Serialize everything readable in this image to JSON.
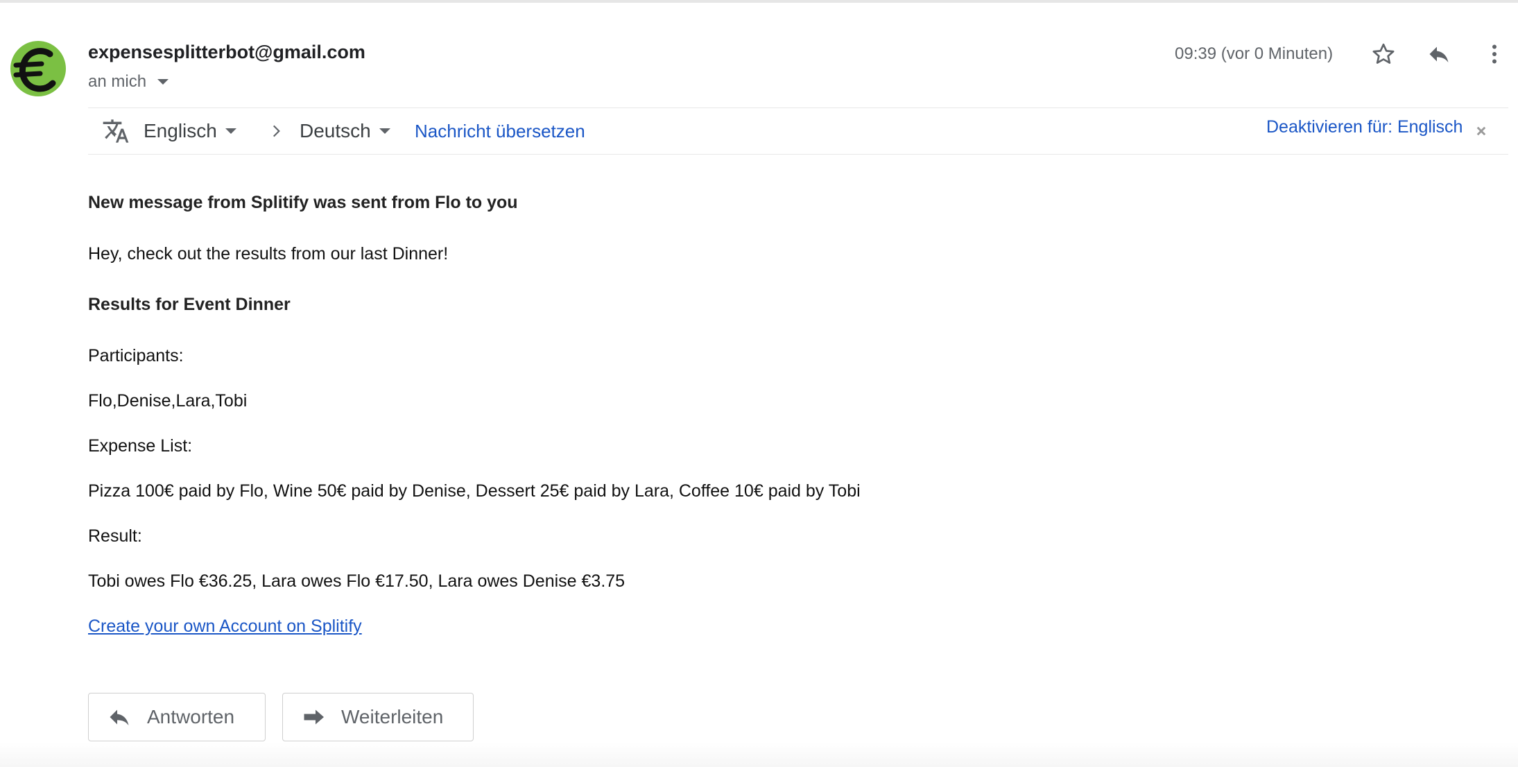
{
  "header": {
    "sender": "expensesplitterbot@gmail.com",
    "recipient": "an mich",
    "timestamp": "09:39 (vor 0 Minuten)",
    "icons": [
      "euro-icon",
      "star-icon",
      "reply-icon",
      "more-vert-icon"
    ]
  },
  "translate": {
    "from_lang": "Englisch",
    "to_lang": "Deutsch",
    "translate_label": "Nachricht übersetzen",
    "disable_label": "Deaktivieren für: Englisch"
  },
  "message": {
    "heading": "New message from Splitify was sent from Flo to you",
    "greeting": "Hey, check out the results from our last Dinner!",
    "results_title": "Results for Event Dinner",
    "participants_label": "Participants:",
    "participants": "Flo,Denise,Lara,Tobi",
    "expense_label": "Expense List:",
    "expenses": "Pizza 100€ paid by Flo, Wine 50€ paid by Denise, Dessert 25€ paid by Lara, Coffee 10€ paid by Tobi",
    "result_label": "Result:",
    "result": "Tobi owes Flo €36.25, Lara owes Flo €17.50, Lara owes Denise €3.75",
    "link": "Create your own Account on Splitify"
  },
  "actions": {
    "reply_label": "Antworten",
    "forward_label": "Weiterleiten"
  },
  "colors": {
    "avatar_green": "#7bc043",
    "link_blue": "#1a56c6"
  }
}
